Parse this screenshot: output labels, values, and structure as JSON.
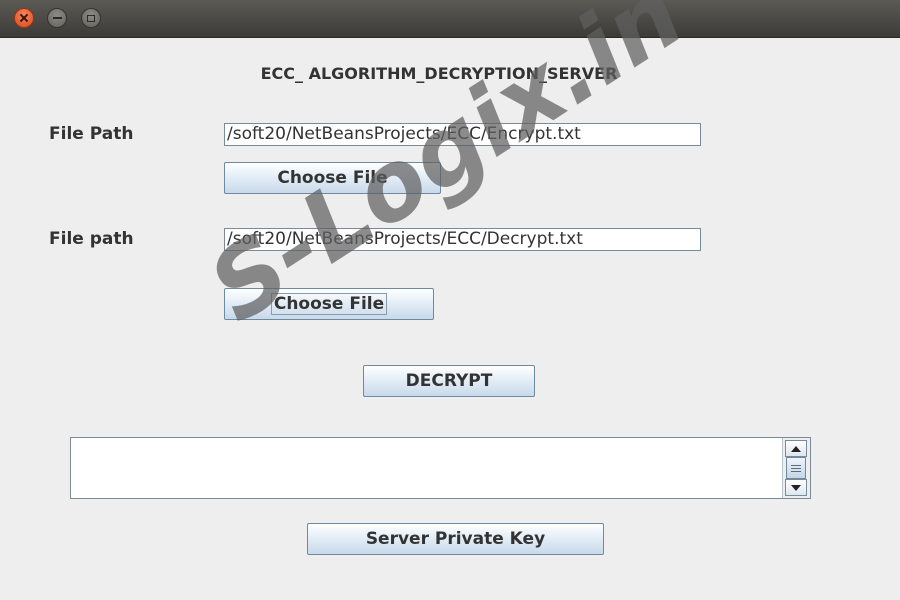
{
  "heading": "ECC_ ALGORITHM_DECRYPTION_SERVER",
  "encrypt_section": {
    "label": "File Path",
    "path_value": "/soft20/NetBeansProjects/ECC/Encrypt.txt",
    "choose_button": "Choose File"
  },
  "decrypt_section": {
    "label": "File path",
    "path_value": "/soft20/NetBeansProjects/ECC/Decrypt.txt",
    "choose_button": "Choose File"
  },
  "decrypt_button": "DECRYPT",
  "output_text": "",
  "server_key_button": "Server Private Key",
  "watermark": "S-Logix.in",
  "colors": {
    "close_button": "#e95420",
    "background": "#eeeeee"
  },
  "icons": [
    "close-icon",
    "minimize-icon",
    "maximize-icon",
    "scroll-up-icon",
    "scroll-down-icon",
    "scroll-grip-icon"
  ]
}
